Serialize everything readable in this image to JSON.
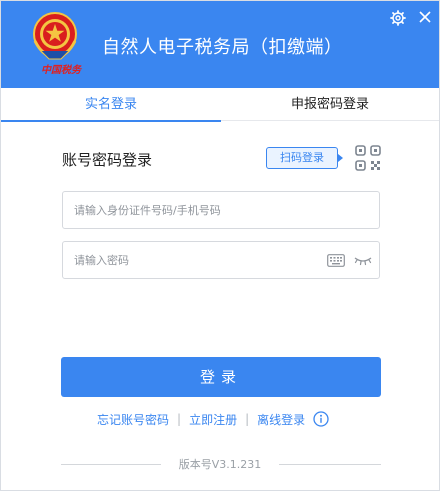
{
  "header": {
    "title": "自然人电子税务局（扣缴端）",
    "tagline": "中国税务",
    "icons": [
      "emblem-icon",
      "settings-icon",
      "close-icon"
    ]
  },
  "tabs": [
    {
      "label": "实名登录",
      "active": true
    },
    {
      "label": "申报密码登录",
      "active": false
    }
  ],
  "login": {
    "section_title": "账号密码登录",
    "scan_label": "扫码登录",
    "id_placeholder": "请输入身份证件号码/手机号码",
    "password_placeholder": "请输入密码",
    "submit_label": "登录"
  },
  "links": {
    "forgot": "忘记账号密码",
    "register": "立即注册",
    "offline": "离线登录"
  },
  "footer": {
    "version": "版本号V3.1.231"
  },
  "colors": {
    "accent": "#3a86f0",
    "tagline_red": "#e02020"
  }
}
